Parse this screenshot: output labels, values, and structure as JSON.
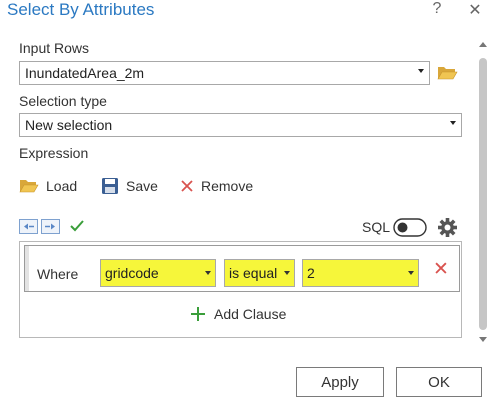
{
  "window": {
    "title": "Select By Attributes",
    "help_glyph": "?",
    "close_glyph": "✕"
  },
  "input_rows": {
    "label": "Input Rows",
    "value": "InundatedArea_2m"
  },
  "selection_type": {
    "label": "Selection type",
    "value": "New selection"
  },
  "expression": {
    "label": "Expression",
    "load_label": "Load",
    "save_label": "Save",
    "remove_label": "Remove",
    "sql_label": "SQL",
    "sql_toggle_on": false
  },
  "clause": {
    "where_label": "Where",
    "field": "gridcode",
    "operator": "is equal",
    "value": "2",
    "highlight_color": "#f6f63a"
  },
  "add_clause_label": "Add Clause",
  "buttons": {
    "apply_label": "Apply",
    "ok_label": "OK"
  },
  "colors": {
    "title": "#2b79c2",
    "remove_x": "#d9534f",
    "check": "#3a9e3a",
    "folder": "#e8b84a",
    "add_plus": "#3a9e3a"
  }
}
